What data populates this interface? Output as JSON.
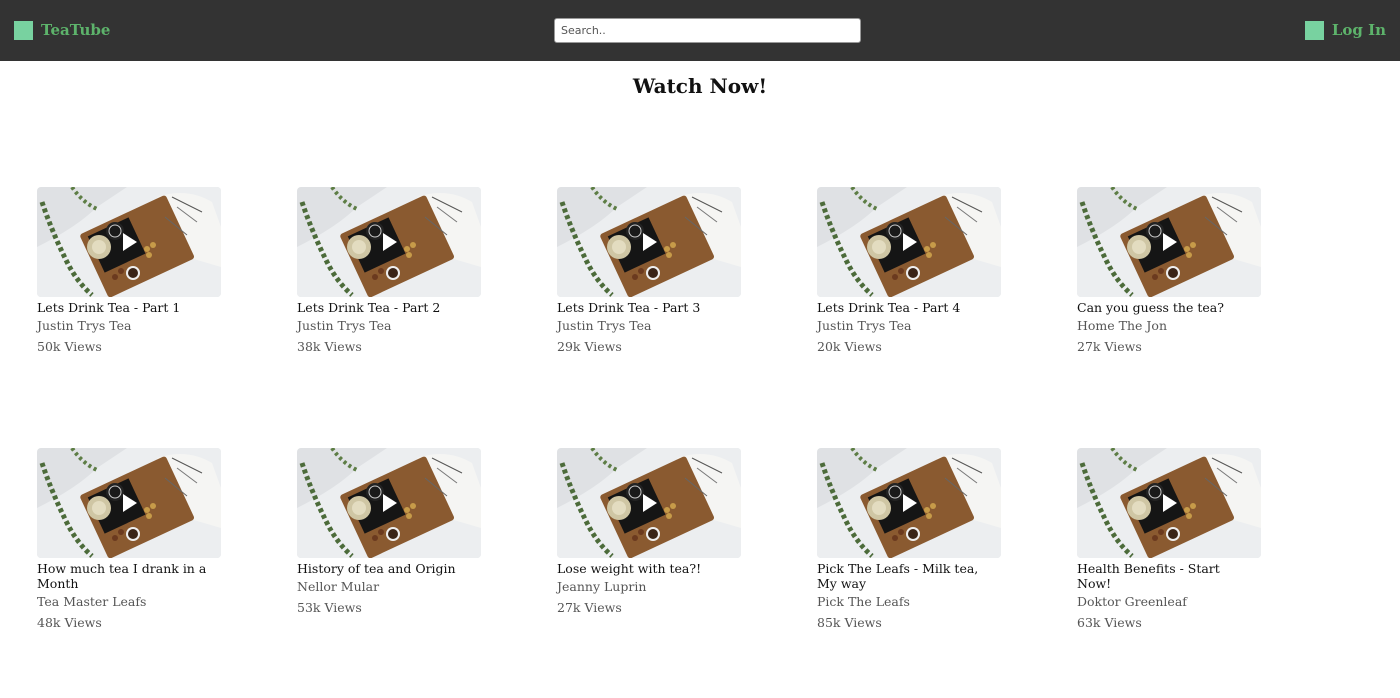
{
  "header": {
    "brand": "TeaTube",
    "search_placeholder": "Search..",
    "login_label": "Log In",
    "accent_color": "#5db36b",
    "logo_color": "#78d2a0",
    "logo_icon": "logo-square-icon"
  },
  "main": {
    "title": "Watch Now!"
  },
  "videos": [
    {
      "title": "Lets Drink Tea - Part 1",
      "channel": "Justin Trys Tea",
      "views": "50k Views"
    },
    {
      "title": "Lets Drink Tea - Part 2",
      "channel": "Justin Trys Tea",
      "views": "38k Views"
    },
    {
      "title": "Lets Drink Tea - Part 3",
      "channel": "Justin Trys Tea",
      "views": "29k Views"
    },
    {
      "title": "Lets Drink Tea - Part 4",
      "channel": "Justin Trys Tea",
      "views": "20k Views"
    },
    {
      "title": "Can you guess the tea?",
      "channel": "Home The Jon",
      "views": "27k Views"
    },
    {
      "title": "How much tea I drank in a Month",
      "channel": "Tea Master Leafs",
      "views": "48k Views"
    },
    {
      "title": "History of tea and Origin",
      "channel": "Nellor Mular",
      "views": "53k Views"
    },
    {
      "title": "Lose weight with tea?!",
      "channel": "Jeanny Luprin",
      "views": "27k Views"
    },
    {
      "title": "Pick The Leafs - Milk tea, My way",
      "channel": "Pick The Leafs",
      "views": "85k Views"
    },
    {
      "title": "Health Benefits - Start Now!",
      "channel": "Doktor Greenleaf",
      "views": "63k Views"
    }
  ]
}
